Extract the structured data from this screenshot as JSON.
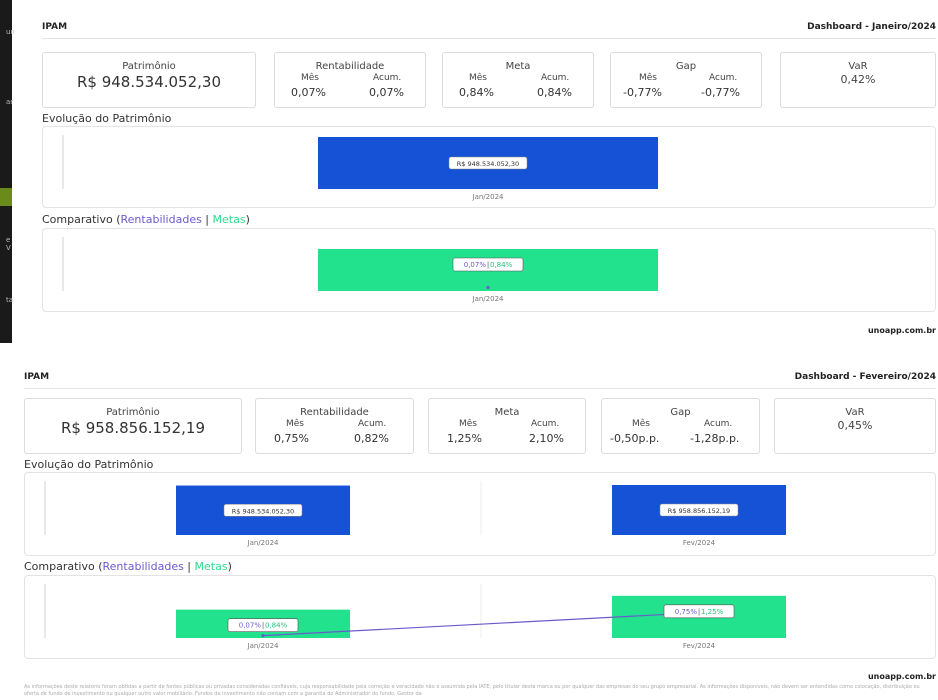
{
  "side_fragments": [
    "un",
    "ar",
    "e V",
    "ta"
  ],
  "reports": [
    {
      "brand": "IPAM",
      "title": "Dashboard - Janeiro/2024",
      "kpis": {
        "patrimonio": {
          "label": "Patrimônio",
          "value": "R$ 948.534.052,30"
        },
        "rentabilidade": {
          "label": "Rentabilidade",
          "mes_label": "Mês",
          "acum_label": "Acum.",
          "mes": "0,07%",
          "acum": "0,07%"
        },
        "meta": {
          "label": "Meta",
          "mes_label": "Mês",
          "acum_label": "Acum.",
          "mes": "0,84%",
          "acum": "0,84%"
        },
        "gap": {
          "label": "Gap",
          "mes_label": "Mês",
          "acum_label": "Acum.",
          "mes": "-0,77%",
          "acum": "-0,77%"
        },
        "var": {
          "label": "VaR",
          "value": "0,42%"
        }
      },
      "evolucao": {
        "title": "Evolução do Patrimônio"
      },
      "comparativo": {
        "title_prefix": "Comparativo (",
        "rent_label": "Rentabilidades",
        "sep": " | ",
        "metas_label": "Metas",
        "title_suffix": ")"
      },
      "site": "unoapp.com.br",
      "chart_data": [
        {
          "type": "bar",
          "categories": [
            "Jan/2024"
          ],
          "values": [
            948534052.3
          ],
          "data_labels": [
            "R$ 948.534.052,30"
          ],
          "color": "#1552d6"
        },
        {
          "type": "bar",
          "categories": [
            "Jan/2024"
          ],
          "series": [
            {
              "name": "Metas",
              "values": [
                0.84
              ],
              "color": "#22e28e"
            },
            {
              "name": "Rentabilidades",
              "values": [
                0.07
              ],
              "color": "#6a5acd"
            }
          ],
          "data_labels_rent": [
            "0,07%"
          ],
          "data_labels_meta": [
            "0,84%"
          ],
          "ylim": [
            0,
            1.6
          ]
        }
      ]
    },
    {
      "brand": "IPAM",
      "title": "Dashboard - Fevereiro/2024",
      "kpis": {
        "patrimonio": {
          "label": "Patrimônio",
          "value": "R$ 958.856.152,19"
        },
        "rentabilidade": {
          "label": "Rentabilidade",
          "mes_label": "Mês",
          "acum_label": "Acum.",
          "mes": "0,75%",
          "acum": "0,82%"
        },
        "meta": {
          "label": "Meta",
          "mes_label": "Mês",
          "acum_label": "Acum.",
          "mes": "1,25%",
          "acum": "2,10%"
        },
        "gap": {
          "label": "Gap",
          "mes_label": "Mês",
          "acum_label": "Acum.",
          "mes": "-0,50p.p.",
          "acum": "-1,28p.p."
        },
        "var": {
          "label": "VaR",
          "value": "0,45%"
        }
      },
      "evolucao": {
        "title": "Evolução do Patrimônio"
      },
      "comparativo": {
        "title_prefix": "Comparativo (",
        "rent_label": "Rentabilidades",
        "sep": " | ",
        "metas_label": "Metas",
        "title_suffix": ")"
      },
      "site": "unoapp.com.br",
      "disclaimer": "As informações deste relatório foram obtidas a partir de fontes públicas ou privadas consideradas confiáveis, cuja responsabilidade pela correção e veracidade não é assumida pela IATE, pelo titular desta marca ou por qualquer das empresas do seu grupo empresarial. As informações disponíveis, não devem ser entendidas como colocação, distribuição ou oferta de fundo de investimento ou qualquer outro valor mobiliário. Fundos de investimento não contam com a garantia do Administrador do fundo, Gestor da",
      "chart_data": [
        {
          "type": "bar",
          "categories": [
            "Jan/2024",
            "Fev/2024"
          ],
          "values": [
            948534052.3,
            958856152.19
          ],
          "data_labels": [
            "R$ 948.534.052,30",
            "R$ 958.856.152,19"
          ],
          "color": "#1552d6"
        },
        {
          "type": "bar",
          "categories": [
            "Jan/2024",
            "Fev/2024"
          ],
          "series": [
            {
              "name": "Metas",
              "values": [
                0.84,
                1.25
              ],
              "color": "#22e28e"
            },
            {
              "name": "Rentabilidades",
              "values": [
                0.07,
                0.75
              ],
              "color": "#6a5acd"
            }
          ],
          "data_labels_rent": [
            "0,07%",
            "0,75%"
          ],
          "data_labels_meta": [
            "0,84%",
            "1,25%"
          ],
          "ylim": [
            0,
            1.6
          ]
        }
      ]
    }
  ]
}
